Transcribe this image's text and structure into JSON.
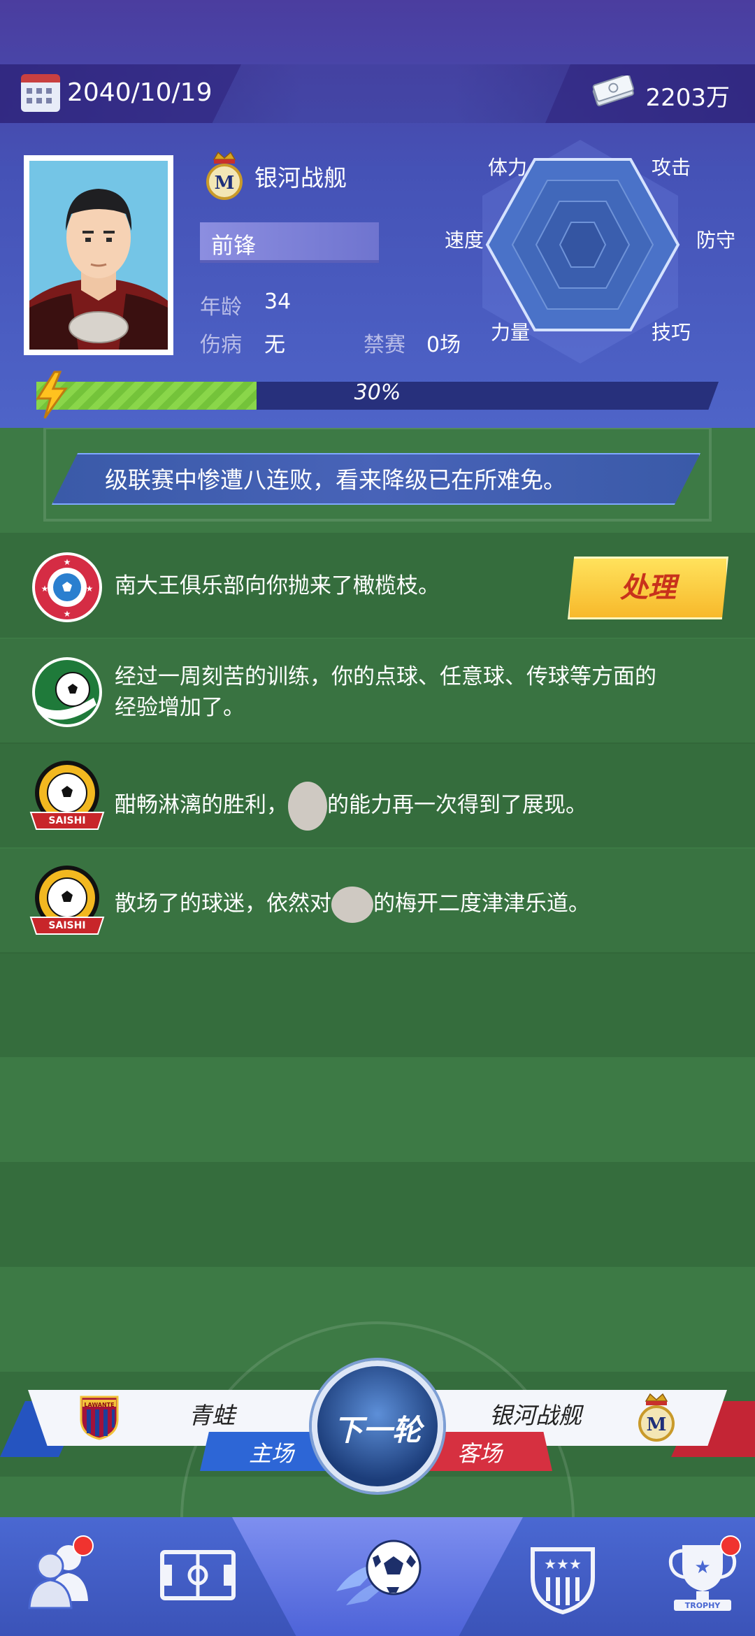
{
  "header": {
    "date": "2040/10/19",
    "money": "2203万"
  },
  "player": {
    "club_name": "银河战舰",
    "position": "前锋",
    "age_label": "年龄",
    "age_value": "34",
    "injury_label": "伤病",
    "injury_value": "无",
    "ban_label": "禁赛",
    "ban_value": "0场",
    "energy_text": "30%",
    "energy_fraction": 0.3
  },
  "radar": {
    "labels": {
      "stamina": "体力",
      "attack": "攻击",
      "speed": "速度",
      "defense": "防守",
      "power": "力量",
      "skill": "技巧"
    }
  },
  "banner": {
    "text": "级联赛中惨遭八连败，看来降级已在所难免。"
  },
  "news": [
    {
      "text": "南大王俱乐部向你抛来了橄榄枝。",
      "icon": "club-offer-icon"
    },
    {
      "text": "经过一周刻苦的训练，你的点球、任意球、传球等方面的经验增加了。",
      "icon": "training-icon"
    },
    {
      "text": "酣畅淋漓的胜利，",
      "text2": "的能力再一次得到了展现。",
      "icon": "saishi-icon",
      "icon_label": "SAISHI"
    },
    {
      "text": "散场了的球迷，依然对",
      "text2": "的梅开二度津津乐道。",
      "icon": "saishi-icon",
      "icon_label": "SAISHI"
    }
  ],
  "process_button": "处理",
  "match": {
    "home_team": "青蛙",
    "home_badge_text": "LAWANTE",
    "home_tag": "主场",
    "away_team": "银河战舰",
    "away_tag": "客场",
    "next_button": "下一轮"
  },
  "nav": {
    "trophy_label": "TROPHY"
  },
  "colors": {
    "header_bg": "#4552b6",
    "field_green": "#3d7a45",
    "energy_green": "#8ad64a",
    "home_blue": "#2d66d6",
    "away_red": "#d63040",
    "process_yellow": "#f7b92b",
    "badge_red": "#f0332f"
  }
}
